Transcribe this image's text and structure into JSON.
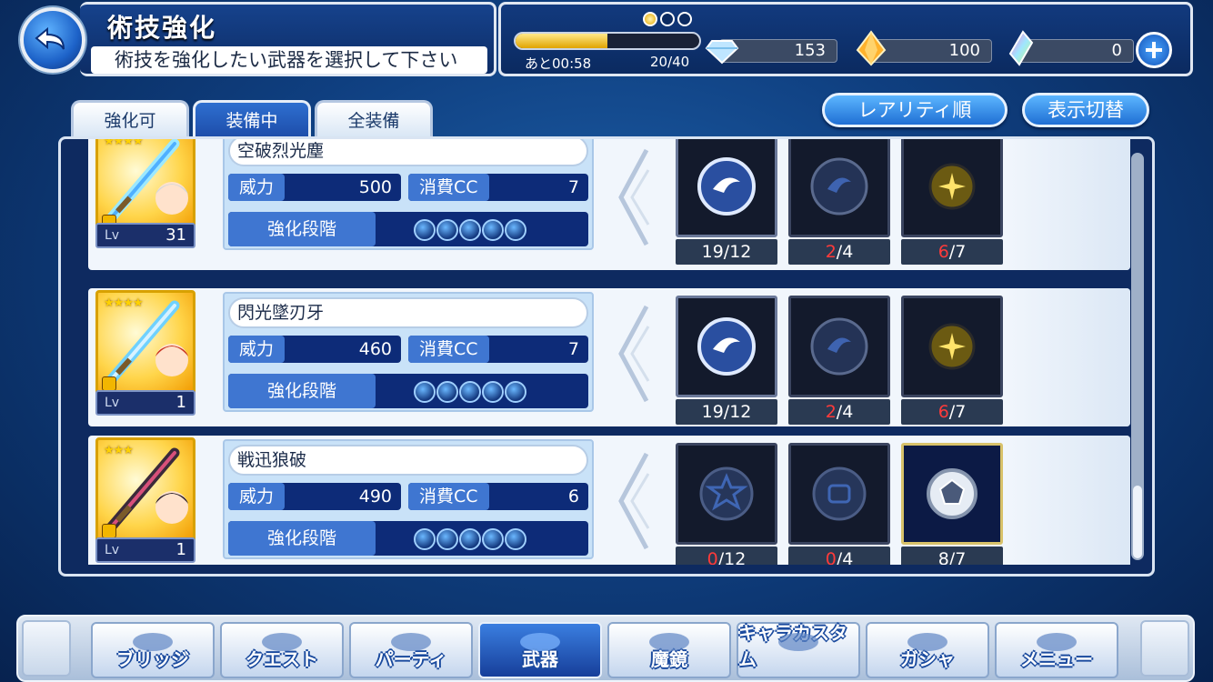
{
  "header": {
    "title": "術技強化",
    "instruction": "術技を強化したい武器を選択して下さい",
    "stamina_timer": "あと00:58",
    "stamina_count": "20/40",
    "stamina_fraction": 0.5,
    "gems": "153",
    "crystals": "100",
    "shards": "0"
  },
  "tabs": [
    "強化可",
    "装備中",
    "全装備"
  ],
  "active_tab": 1,
  "buttons": {
    "sort": "レアリティ順",
    "toggle_view": "表示切替"
  },
  "weapons": [
    {
      "stars": "★★★★",
      "level_label": "Lv",
      "level": "31",
      "skill": "空破烈光塵",
      "power_label": "威力",
      "power": "500",
      "cc_label": "消費CC",
      "cc": "7",
      "stage_label": "強化段階",
      "mats": [
        {
          "have": "19",
          "need": "/12",
          "short": false
        },
        {
          "have": "2",
          "need": "/4",
          "short": true
        },
        {
          "have": "6",
          "need": "/7",
          "short": true
        }
      ]
    },
    {
      "stars": "★★★★",
      "level_label": "Lv",
      "level": "1",
      "skill": "閃光墜刃牙",
      "power_label": "威力",
      "power": "460",
      "cc_label": "消費CC",
      "cc": "7",
      "stage_label": "強化段階",
      "mats": [
        {
          "have": "19",
          "need": "/12",
          "short": false
        },
        {
          "have": "2",
          "need": "/4",
          "short": true
        },
        {
          "have": "6",
          "need": "/7",
          "short": true
        }
      ]
    },
    {
      "stars": "★★★",
      "level_label": "Lv",
      "level": "1",
      "skill": "戦迅狼破",
      "power_label": "威力",
      "power": "490",
      "cc_label": "消費CC",
      "cc": "6",
      "stage_label": "強化段階",
      "mats": [
        {
          "have": "0",
          "need": "/12",
          "short": true
        },
        {
          "have": "0",
          "need": "/4",
          "short": true
        },
        {
          "have": "8",
          "need": "/7",
          "short": false
        }
      ]
    }
  ],
  "nav": [
    "ブリッジ",
    "クエスト",
    "パーティ",
    "武器",
    "魔鏡",
    "キャラカスタム",
    "ガシャ",
    "メニュー"
  ],
  "active_nav": 3
}
